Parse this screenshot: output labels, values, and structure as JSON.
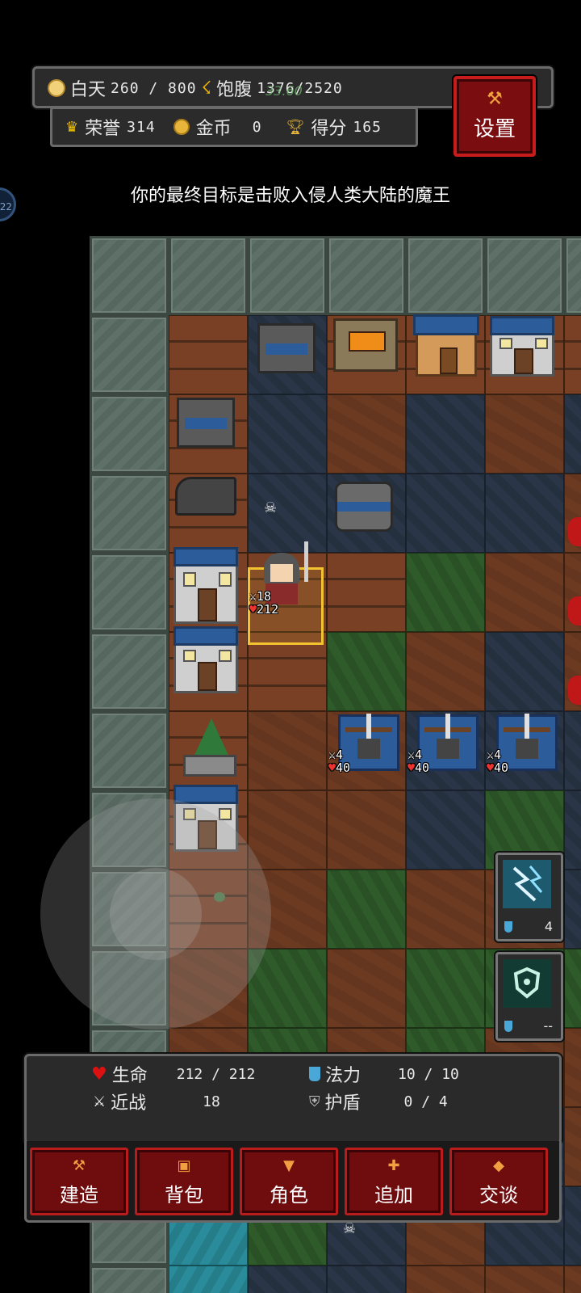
{
  "top_bar": {
    "day_label": "白天",
    "day_value": "260 / 800",
    "hunger_label": "饱腹",
    "hunger_value": "1376/2520",
    "hunger_ghost": "33.60"
  },
  "stats_bar": {
    "honor_label": "荣誉",
    "honor_value": "314",
    "gold_label": "金币",
    "gold_value": "0",
    "score_label": "得分",
    "score_value": "165"
  },
  "settings": {
    "label": "设置",
    "icon": "hammer-icon"
  },
  "goal_text": "你的最终目标是击败入侵人类大陆的魔王",
  "side_badge": "22",
  "hero": {
    "attack": "18",
    "hp": "212"
  },
  "crossbows": [
    {
      "attack": "4",
      "hp": "40"
    },
    {
      "attack": "4",
      "hp": "40"
    },
    {
      "attack": "4",
      "hp": "40"
    }
  ],
  "spells": [
    {
      "icon": "lightning-icon",
      "cost": "4"
    },
    {
      "icon": "shield-rune-icon",
      "cost": "--"
    }
  ],
  "player_stats": {
    "life_label": "生命",
    "life_value": "212 / 212",
    "mana_label": "法力",
    "mana_value": "10 / 10",
    "melee_label": "近战",
    "melee_value": "18",
    "shield_label": "护盾",
    "shield_value": "0 / 4"
  },
  "actions": [
    {
      "label": "建造",
      "icon": "build-icon"
    },
    {
      "label": "背包",
      "icon": "backpack-icon"
    },
    {
      "label": "角色",
      "icon": "character-icon"
    },
    {
      "label": "追加",
      "icon": "plus-icon"
    },
    {
      "label": "交谈",
      "icon": "talk-icon"
    }
  ],
  "colors": {
    "accent_red": "#7a0d10",
    "gold": "#f2c230"
  }
}
